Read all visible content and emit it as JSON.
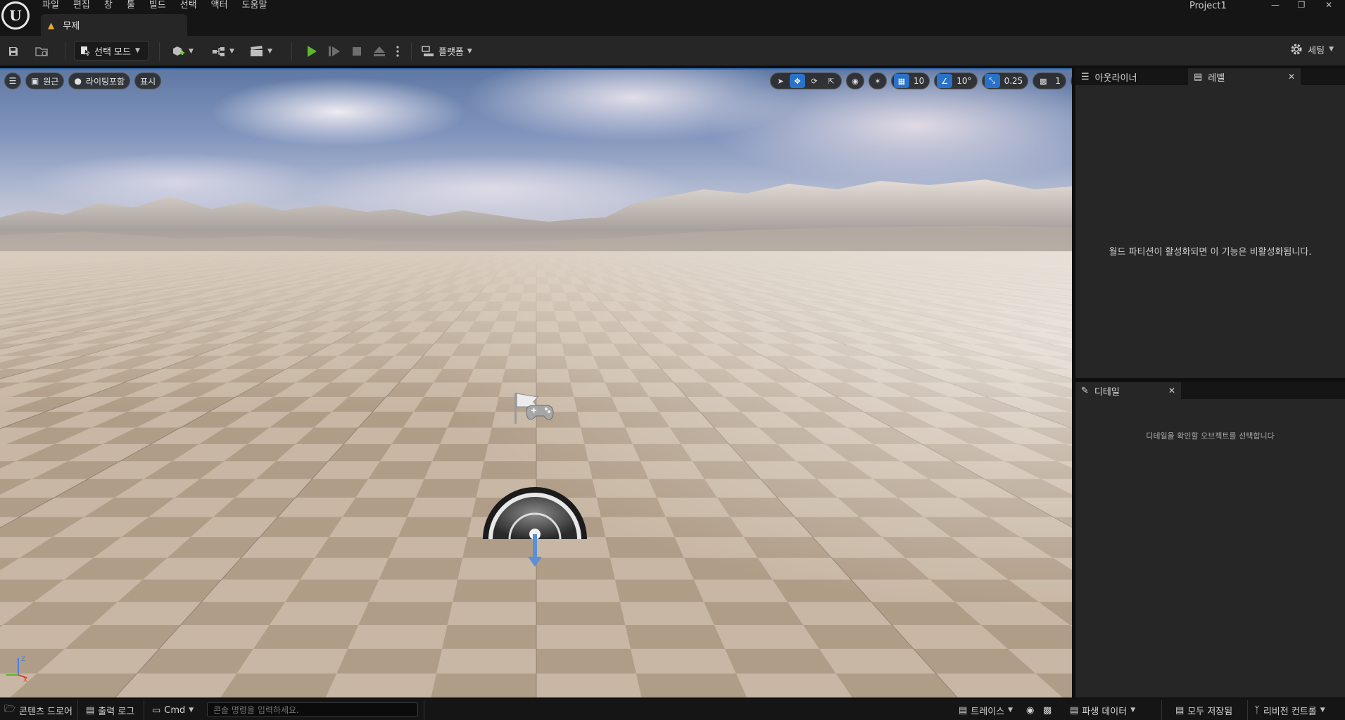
{
  "app": {
    "project_name": "Project1",
    "document_tab": "무제",
    "menu": [
      "파일",
      "편집",
      "창",
      "툴",
      "빌드",
      "선택",
      "액터",
      "도움말"
    ]
  },
  "toolbar": {
    "mode_label": "선택 모드",
    "platform_label": "플랫폼",
    "settings_label": "세팅"
  },
  "viewport": {
    "perspective_label": "원근",
    "lit_label": "라이팅포함",
    "show_label": "표시",
    "grid_snap_value": "10",
    "rotation_snap_value": "10°",
    "scale_snap_value": "0.25",
    "camera_speed_value": "1",
    "accent_color": "#2a72c9"
  },
  "panels": {
    "outliner_tab": "아웃라이너",
    "levels_tab": "레벨",
    "levels_message": "월드 파티션이 활성화되면 이 기능은 비활성화됩니다.",
    "details_tab": "디테일",
    "details_message": "디테일을 확인할 오브젝트를 선택합니다"
  },
  "statusbar": {
    "content_drawer": "콘텐츠 드로어",
    "output_log": "출력 로그",
    "cmd_label": "Cmd",
    "cmd_placeholder": "콘솔 명령을 입력하세요.",
    "trace_label": "트레이스",
    "derived_data_label": "파생 데이터",
    "save_all_label": "모두 저장됨",
    "revision_control_label": "리비전 컨트롤"
  }
}
